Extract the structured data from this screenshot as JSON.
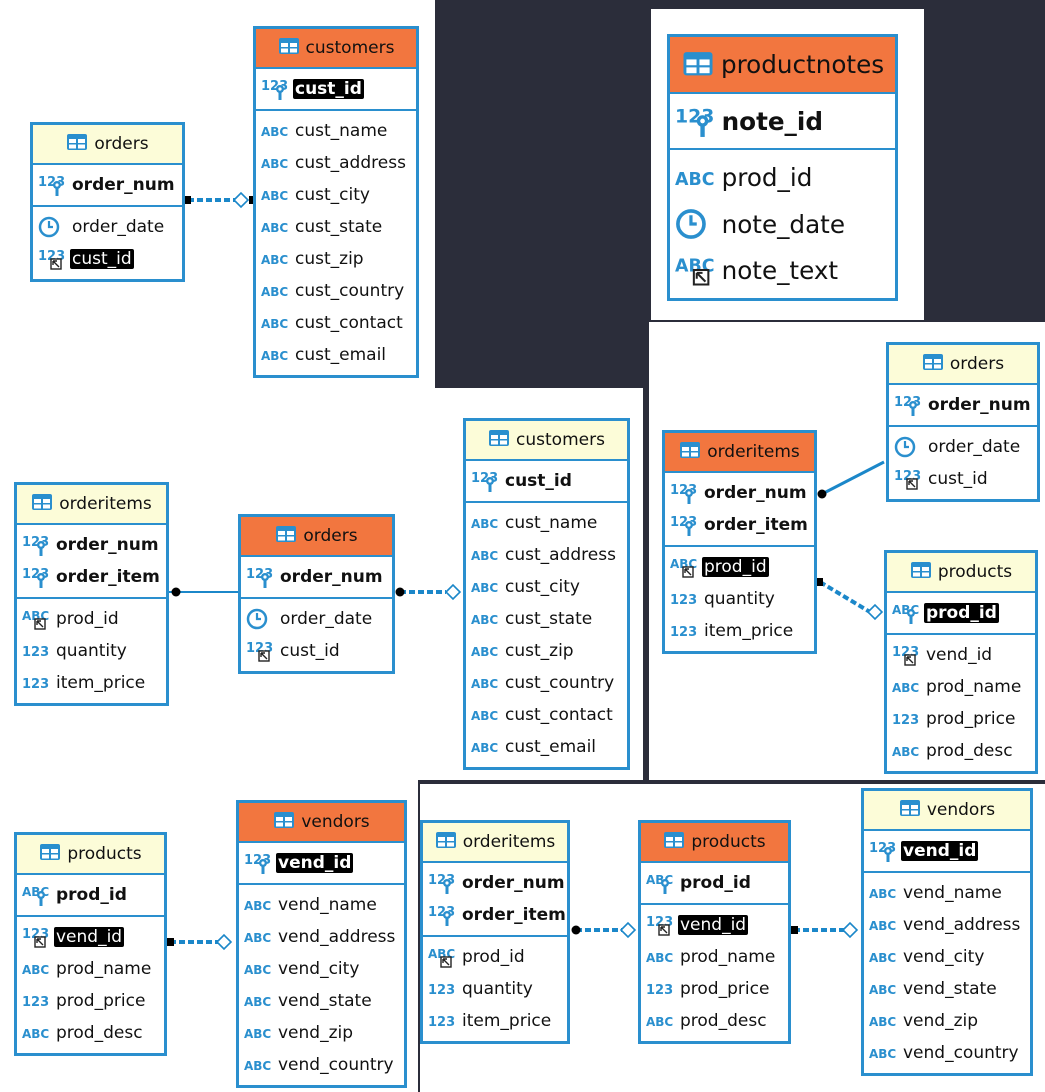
{
  "colors": {
    "border": "#2a8fce",
    "header_primary": "#f2763f",
    "header_related": "#fcfcd8",
    "background": "#2b2d3a",
    "highlight": "#000000"
  },
  "icons": {
    "table": "table-icon",
    "key_number": "key-number-icon",
    "text": "text-type-icon",
    "number": "number-type-icon",
    "date": "clock-icon",
    "ref_number": "reference-number-icon",
    "ref_text": "reference-text-icon",
    "key_text": "key-text-icon"
  },
  "diagrams": {
    "d1": {
      "orders": {
        "name": "orders",
        "keys": [
          "order_num"
        ],
        "cols": [
          "order_date",
          "cust_id"
        ]
      },
      "customers": {
        "name": "customers",
        "keys": [
          "cust_id"
        ],
        "cols": [
          "cust_name",
          "cust_address",
          "cust_city",
          "cust_state",
          "cust_zip",
          "cust_country",
          "cust_contact",
          "cust_email"
        ]
      }
    },
    "d2": {
      "productnotes": {
        "name": "productnotes",
        "keys": [
          "note_id"
        ],
        "cols": [
          "prod_id",
          "note_date",
          "note_text"
        ]
      }
    },
    "d3": {
      "orderitems": {
        "name": "orderitems",
        "keys": [
          "order_num",
          "order_item"
        ],
        "cols": [
          "prod_id",
          "quantity",
          "item_price"
        ]
      },
      "orders": {
        "name": "orders",
        "keys": [
          "order_num"
        ],
        "cols": [
          "order_date",
          "cust_id"
        ]
      },
      "customers": {
        "name": "customers",
        "keys": [
          "cust_id"
        ],
        "cols": [
          "cust_name",
          "cust_address",
          "cust_city",
          "cust_state",
          "cust_zip",
          "cust_country",
          "cust_contact",
          "cust_email"
        ]
      }
    },
    "d4": {
      "orderitems": {
        "name": "orderitems",
        "keys": [
          "order_num",
          "order_item"
        ],
        "cols": [
          "prod_id",
          "quantity",
          "item_price"
        ]
      },
      "orders": {
        "name": "orders",
        "keys": [
          "order_num"
        ],
        "cols": [
          "order_date",
          "cust_id"
        ]
      },
      "products": {
        "name": "products",
        "keys": [
          "prod_id"
        ],
        "cols": [
          "vend_id",
          "prod_name",
          "prod_price",
          "prod_desc"
        ]
      }
    },
    "d5": {
      "products": {
        "name": "products",
        "keys": [
          "prod_id"
        ],
        "cols": [
          "vend_id",
          "prod_name",
          "prod_price",
          "prod_desc"
        ]
      },
      "vendors": {
        "name": "vendors",
        "keys": [
          "vend_id"
        ],
        "cols": [
          "vend_name",
          "vend_address",
          "vend_city",
          "vend_state",
          "vend_zip",
          "vend_country"
        ]
      }
    },
    "d6": {
      "orderitems": {
        "name": "orderitems",
        "keys": [
          "order_num",
          "order_item"
        ],
        "cols": [
          "prod_id",
          "quantity",
          "item_price"
        ]
      },
      "products": {
        "name": "products",
        "keys": [
          "prod_id"
        ],
        "cols": [
          "vend_id",
          "prod_name",
          "prod_price",
          "prod_desc"
        ]
      },
      "vendors": {
        "name": "vendors",
        "keys": [
          "vend_id"
        ],
        "cols": [
          "vend_name",
          "vend_address",
          "vend_city",
          "vend_state",
          "vend_zip",
          "vend_country"
        ]
      }
    }
  }
}
